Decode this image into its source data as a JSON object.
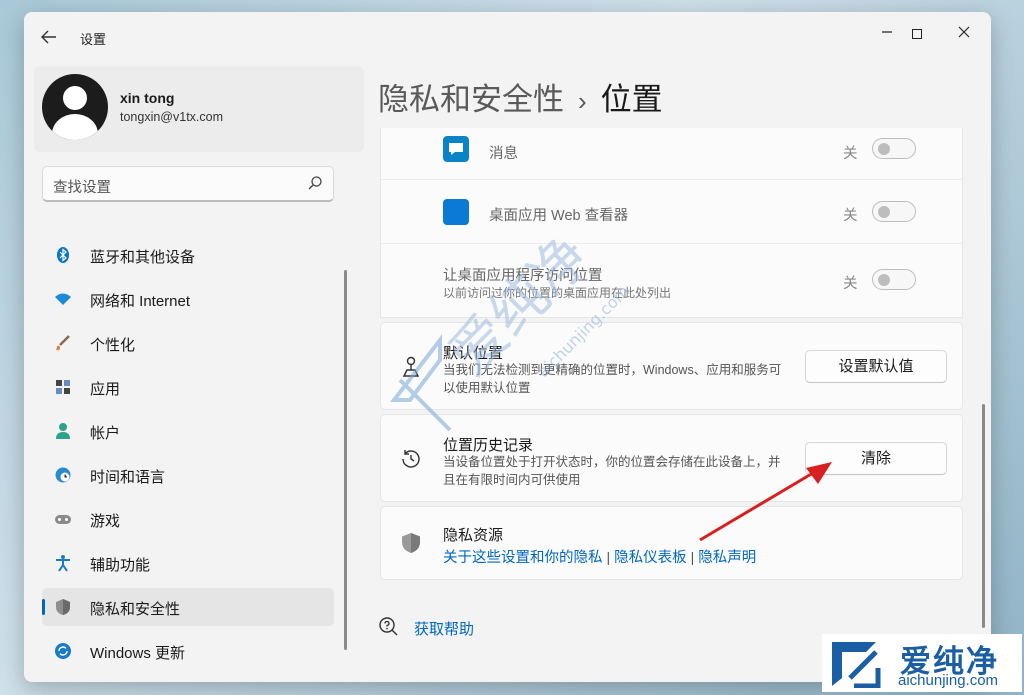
{
  "window": {
    "title": "设置"
  },
  "profile": {
    "name": "xin tong",
    "email": "tongxin@v1tx.com"
  },
  "search": {
    "placeholder": "查找设置"
  },
  "sidebar": {
    "items": [
      {
        "label": "蓝牙和其他设备",
        "icon": "bluetooth-icon"
      },
      {
        "label": "网络和 Internet",
        "icon": "wifi-icon"
      },
      {
        "label": "个性化",
        "icon": "brush-icon"
      },
      {
        "label": "应用",
        "icon": "apps-icon"
      },
      {
        "label": "帐户",
        "icon": "person-icon"
      },
      {
        "label": "时间和语言",
        "icon": "globe-clock-icon"
      },
      {
        "label": "游戏",
        "icon": "gamepad-icon"
      },
      {
        "label": "辅助功能",
        "icon": "accessibility-icon"
      },
      {
        "label": "隐私和安全性",
        "icon": "shield-icon",
        "active": true
      },
      {
        "label": "Windows 更新",
        "icon": "update-icon"
      }
    ]
  },
  "breadcrumb": {
    "parent": "隐私和安全性",
    "separator": "›",
    "current": "位置"
  },
  "app_rows": [
    {
      "label": "消息",
      "state": "关",
      "icon": "message-app-icon",
      "color": "#0a84c6"
    },
    {
      "label": "桌面应用 Web 查看器",
      "state": "关",
      "icon": "webview-app-icon",
      "color": "#0a7ad6"
    }
  ],
  "desktop_access": {
    "label": "让桌面应用程序访问位置",
    "sub": "以前访问过你的位置的桌面应用在此处列出",
    "state": "关"
  },
  "default_location": {
    "label": "默认位置",
    "desc": "当我们无法检测到更精确的位置时，Windows、应用和服务可以使用默认位置",
    "button": "设置默认值"
  },
  "location_history": {
    "label": "位置历史记录",
    "desc": "当设备位置处于打开状态时，你的位置会存储在此设备上，并且在有限时间内可供使用",
    "button": "清除"
  },
  "privacy_resources": {
    "label": "隐私资源",
    "links": [
      "关于这些设置和你的隐私",
      "隐私仪表板",
      "隐私声明"
    ],
    "separator": "|"
  },
  "help": {
    "label": "获取帮助"
  },
  "watermark": {
    "title": "爱纯净",
    "url": "aichunjing.com",
    "center_text": "爱纯净",
    "center_url": "aichunjing.com"
  },
  "colors": {
    "accent": "#0067c0",
    "arrow": "#d92020",
    "watermark": "#1a5fa5"
  }
}
